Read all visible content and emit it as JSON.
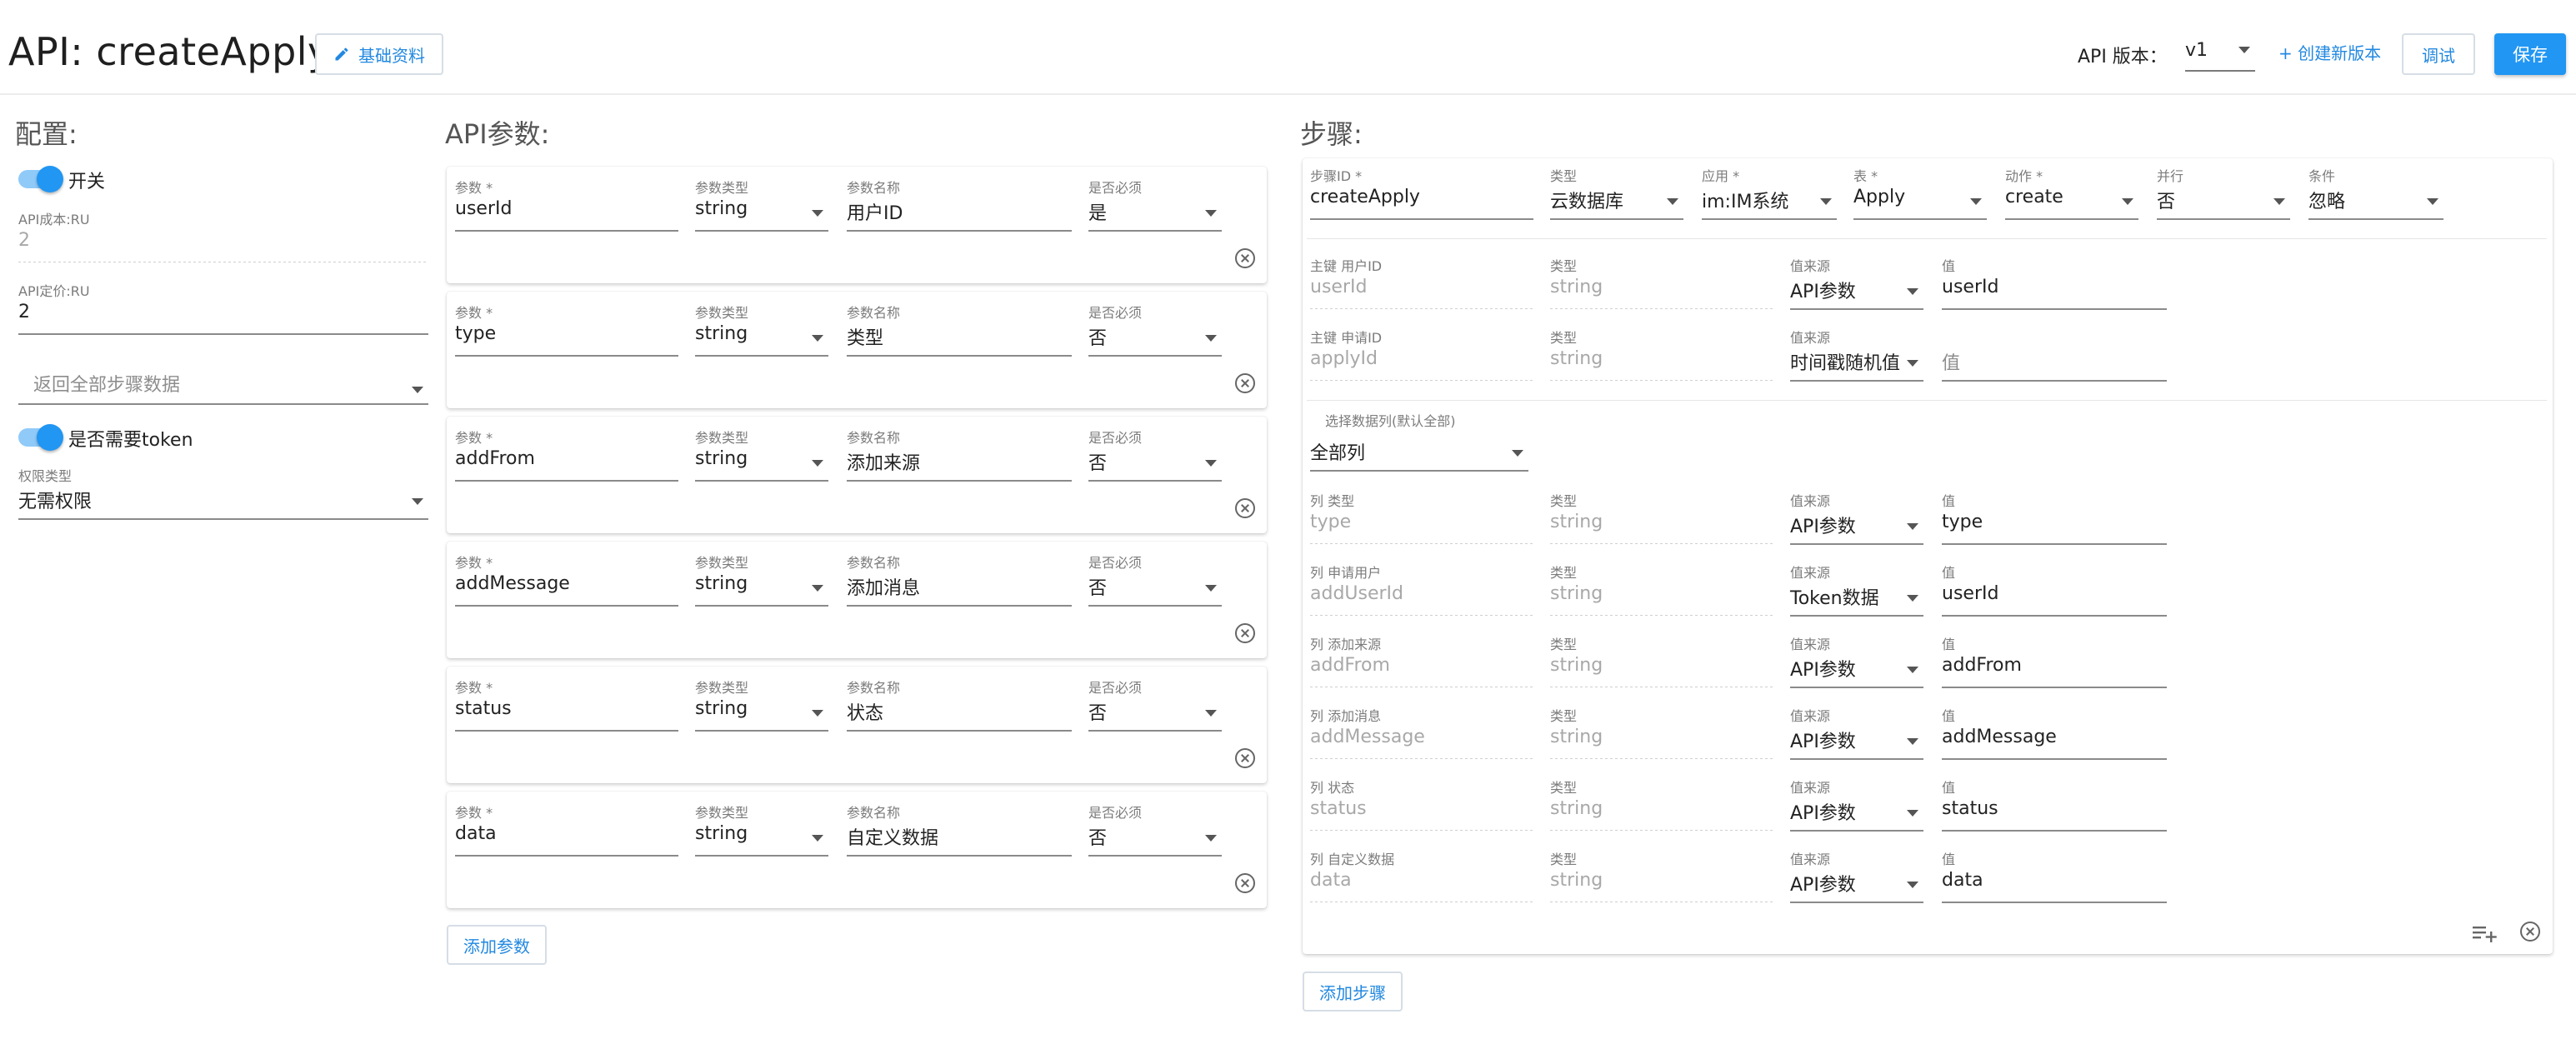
{
  "header": {
    "title": "API: createApply",
    "edit_label": "基础资料",
    "version_label": "API 版本：",
    "version_value": "v1",
    "create_version_label": "+ 创建新版本",
    "debug_label": "调试",
    "save_label": "保存"
  },
  "colors": {
    "primary": "#2196f3",
    "link": "#2288e0",
    "toggle_track": "#90caf9"
  },
  "config": {
    "title": "配置:",
    "switch_label": "开关",
    "cost_label": "API成本:RU",
    "cost_value": "2",
    "price_label": "API定价:RU",
    "price_value": "2",
    "return_placeholder": "返回全部步骤数据",
    "token_label": "是否需要token",
    "perm_label": "权限类型",
    "perm_value": "无需权限"
  },
  "params": {
    "title": "API参数:",
    "col_labels": {
      "param": "参数",
      "type": "参数类型",
      "name": "参数名称",
      "required": "是否必须"
    },
    "items": [
      {
        "param": "userId",
        "type": "string",
        "name": "用户ID",
        "required": "是"
      },
      {
        "param": "type",
        "type": "string",
        "name": "类型",
        "required": "否"
      },
      {
        "param": "addFrom",
        "type": "string",
        "name": "添加来源",
        "required": "否"
      },
      {
        "param": "addMessage",
        "type": "string",
        "name": "添加消息",
        "required": "否"
      },
      {
        "param": "status",
        "type": "string",
        "name": "状态",
        "required": "否"
      },
      {
        "param": "data",
        "type": "string",
        "name": "自定义数据",
        "required": "否"
      }
    ],
    "add_label": "添加参数"
  },
  "steps": {
    "title": "步骤:",
    "step_labels": {
      "id": "步骤ID",
      "kind": "类型",
      "app": "应用",
      "table": "表",
      "action": "动作",
      "parallel": "并行",
      "condition": "条件"
    },
    "step_values": {
      "id": "createApply",
      "kind": "云数据库",
      "app": "im:IM系统",
      "table": "Apply",
      "action": "create",
      "parallel": "否",
      "condition": "忽略"
    },
    "key_rows": [
      {
        "label": "主键 用户ID",
        "field": "userId",
        "type_label": "类型",
        "type": "string",
        "src_label": "值来源",
        "src": "API参数",
        "val_label": "值",
        "val": "userId"
      },
      {
        "label": "主键 申请ID",
        "field": "applyId",
        "type_label": "类型",
        "type": "string",
        "src_label": "值来源",
        "src": "时间戳随机值",
        "val_label": "",
        "val": "值"
      }
    ],
    "columns_label": "选择数据列(默认全部)",
    "columns_value": "全部列",
    "col_rows": [
      {
        "label": "列 类型",
        "field": "type",
        "type_label": "类型",
        "type": "string",
        "src_label": "值来源",
        "src": "API参数",
        "val_label": "值",
        "val": "type"
      },
      {
        "label": "列 申请用户",
        "field": "addUserId",
        "type_label": "类型",
        "type": "string",
        "src_label": "值来源",
        "src": "Token数据",
        "val_label": "值",
        "val": "userId"
      },
      {
        "label": "列 添加来源",
        "field": "addFrom",
        "type_label": "类型",
        "type": "string",
        "src_label": "值来源",
        "src": "API参数",
        "val_label": "值",
        "val": "addFrom"
      },
      {
        "label": "列 添加消息",
        "field": "addMessage",
        "type_label": "类型",
        "type": "string",
        "src_label": "值来源",
        "src": "API参数",
        "val_label": "值",
        "val": "addMessage"
      },
      {
        "label": "列 状态",
        "field": "status",
        "type_label": "类型",
        "type": "string",
        "src_label": "值来源",
        "src": "API参数",
        "val_label": "值",
        "val": "status"
      },
      {
        "label": "列 自定义数据",
        "field": "data",
        "type_label": "类型",
        "type": "string",
        "src_label": "值来源",
        "src": "API参数",
        "val_label": "值",
        "val": "data"
      }
    ],
    "add_label": "添加步骤"
  },
  "icons": {
    "edit": "pencil-icon",
    "dropdown": "caret-down-icon",
    "remove": "close-circle-icon",
    "add_row": "playlist-add-icon"
  }
}
